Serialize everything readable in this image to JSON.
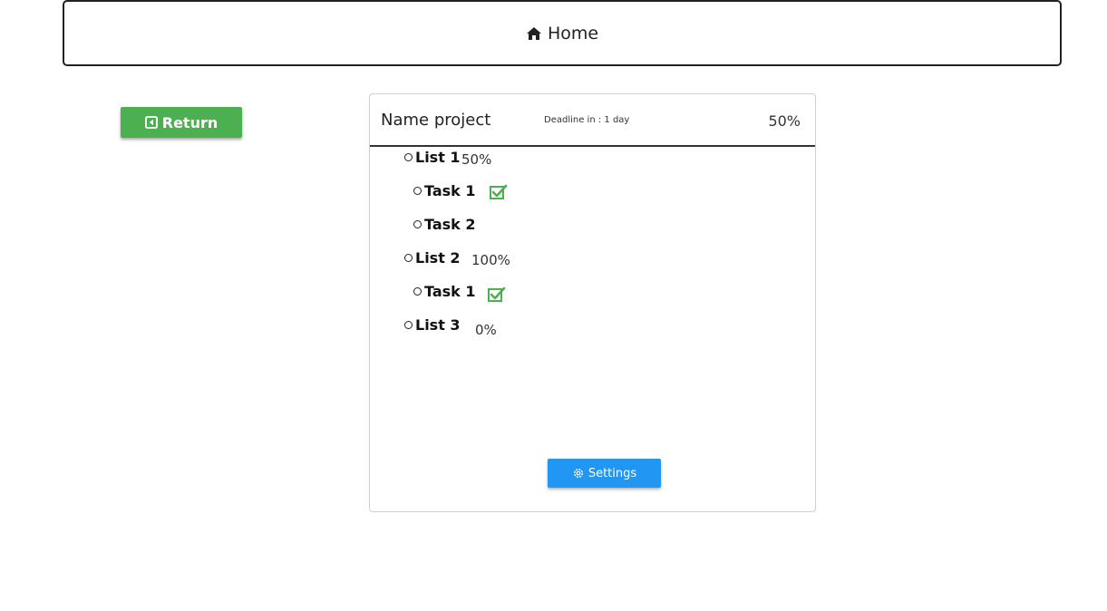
{
  "nav": {
    "home_label": "Home",
    "icon": "home-icon"
  },
  "return_button": {
    "label": "Return",
    "icon": "caret-left-square-icon",
    "color": "#4caf50"
  },
  "project": {
    "name": "Name project",
    "deadline": "Deadline in : 1 day",
    "progress": "50%",
    "lists": [
      {
        "label": "List 1",
        "progress": "50%",
        "tasks": [
          {
            "label": "Task 1",
            "done": true
          },
          {
            "label": "Task 2",
            "done": false
          }
        ]
      },
      {
        "label": "List 2",
        "progress": "100%",
        "tasks": [
          {
            "label": "Task 1",
            "done": true
          }
        ]
      },
      {
        "label": "List 3",
        "progress": "0%",
        "tasks": []
      }
    ]
  },
  "settings_button": {
    "label": "Settings",
    "icon": "gear-icon",
    "color": "#2196f3"
  }
}
